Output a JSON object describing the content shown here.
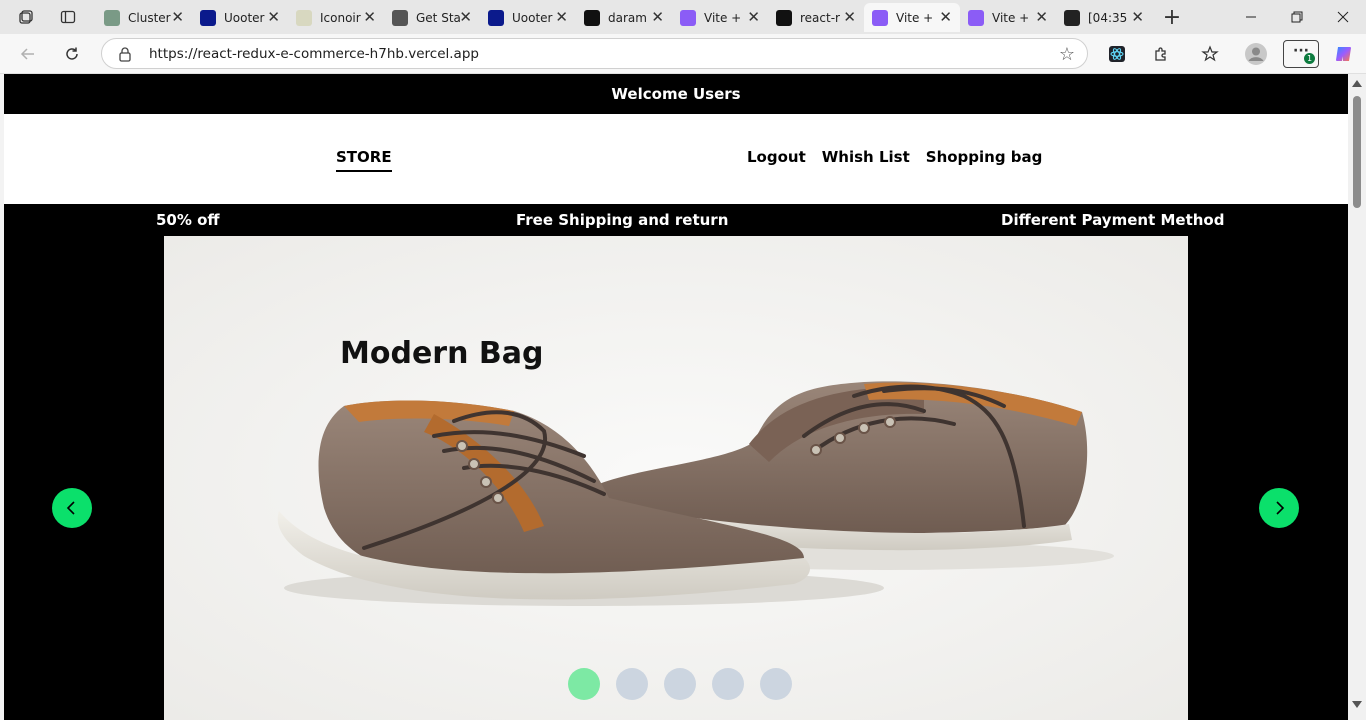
{
  "browser": {
    "tabs": [
      {
        "title": "Cluster",
        "icon": "mongodb-icon",
        "color": "#7a9a86"
      },
      {
        "title": "Uooter",
        "icon": "uooter-icon",
        "color": "#0b1a8c"
      },
      {
        "title": "Iconoir",
        "icon": "iconoir-icon",
        "color": "#d8d8c0"
      },
      {
        "title": "Get Sta",
        "icon": "medium-icon",
        "color": "#555555"
      },
      {
        "title": "Uooter",
        "icon": "uooter-icon",
        "color": "#0b1a8c"
      },
      {
        "title": "daram",
        "icon": "github-icon",
        "color": "#111111"
      },
      {
        "title": "Vite +",
        "icon": "vite-icon",
        "color": "#8b5cf6"
      },
      {
        "title": "react-r",
        "icon": "vercel-icon",
        "color": "#111111"
      },
      {
        "title": "Vite +",
        "icon": "vite-icon",
        "color": "#8b5cf6"
      },
      {
        "title": "Vite +",
        "icon": "vite-icon",
        "color": "#8b5cf6"
      },
      {
        "title": "[04:35",
        "icon": "openai-icon",
        "color": "#222222"
      }
    ],
    "active_tab": 8,
    "url": "https://react-redux-e-commerce-h7hb.vercel.app"
  },
  "page": {
    "welcome": "Welcome Users",
    "brand": "STORE",
    "nav_links": [
      "Logout",
      "Whish List",
      "Shopping bag"
    ],
    "promos": [
      "50% off",
      "Free Shipping and return",
      "Different Payment Method"
    ],
    "slide_title": "Modern Bag",
    "slide_count": 5,
    "active_slide": 0,
    "accent_color": "#0be06b"
  }
}
